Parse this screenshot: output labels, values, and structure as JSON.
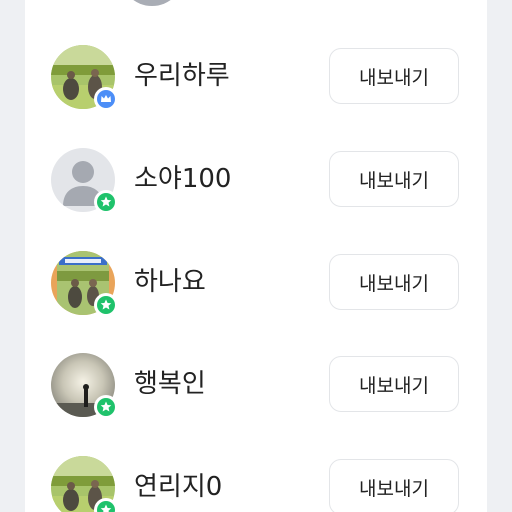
{
  "members": [
    {
      "name": "우리하루",
      "avatar": "photo-field-two-people",
      "badge": "crown-icon",
      "badge_color": "#4c8ef7",
      "button": "내보내기"
    },
    {
      "name": "소야100",
      "avatar": "default-person",
      "badge": "star-icon",
      "badge_color": "#1fc26b",
      "button": "내보내기"
    },
    {
      "name": "하나요",
      "avatar": "photo-field-sign",
      "badge": "star-icon",
      "badge_color": "#1fc26b",
      "button": "내보내기"
    },
    {
      "name": "행복인",
      "avatar": "photo-sunset-silhouette",
      "badge": "star-icon",
      "badge_color": "#1fc26b",
      "button": "내보내기"
    },
    {
      "name": "연리지0",
      "avatar": "photo-field-two-people",
      "badge": "star-icon",
      "badge_color": "#1fc26b",
      "button": "내보내기"
    }
  ]
}
